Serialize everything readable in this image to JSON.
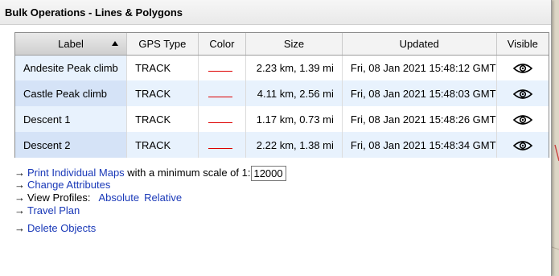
{
  "dialog": {
    "title": "Bulk Operations - Lines & Polygons"
  },
  "table": {
    "headers": {
      "label": "Label",
      "gps_type": "GPS Type",
      "color": "Color",
      "size": "Size",
      "updated": "Updated",
      "visible": "Visible"
    },
    "rows": [
      {
        "label": "Andesite Peak climb",
        "gps_type": "TRACK",
        "color": "#dd0000",
        "size": "2.23 km, 1.39 mi",
        "updated": "Fri, 08 Jan 2021 15:48:12 GMT",
        "visible": "eye-icon"
      },
      {
        "label": "Castle Peak climb",
        "gps_type": "TRACK",
        "color": "#dd0000",
        "size": "4.11 km, 2.56 mi",
        "updated": "Fri, 08 Jan 2021 15:48:03 GMT",
        "visible": "eye-icon"
      },
      {
        "label": "Descent 1",
        "gps_type": "TRACK",
        "color": "#dd0000",
        "size": "1.17 km, 0.73 mi",
        "updated": "Fri, 08 Jan 2021 15:48:26 GMT",
        "visible": "eye-icon"
      },
      {
        "label": "Descent 2",
        "gps_type": "TRACK",
        "color": "#dd0000",
        "size": "2.22 km, 1.38 mi",
        "updated": "Fri, 08 Jan 2021 15:48:34 GMT",
        "visible": "eye-icon"
      }
    ]
  },
  "actions": {
    "arrow": "→",
    "print_maps": "Print Individual Maps",
    "min_scale_text": "with a minimum scale of 1:",
    "min_scale_value": "12000",
    "change_attributes": "Change Attributes",
    "view_profiles": "View Profiles:",
    "absolute": "Absolute",
    "relative": "Relative",
    "travel_plan": "Travel Plan",
    "delete_objects": "Delete Objects"
  }
}
